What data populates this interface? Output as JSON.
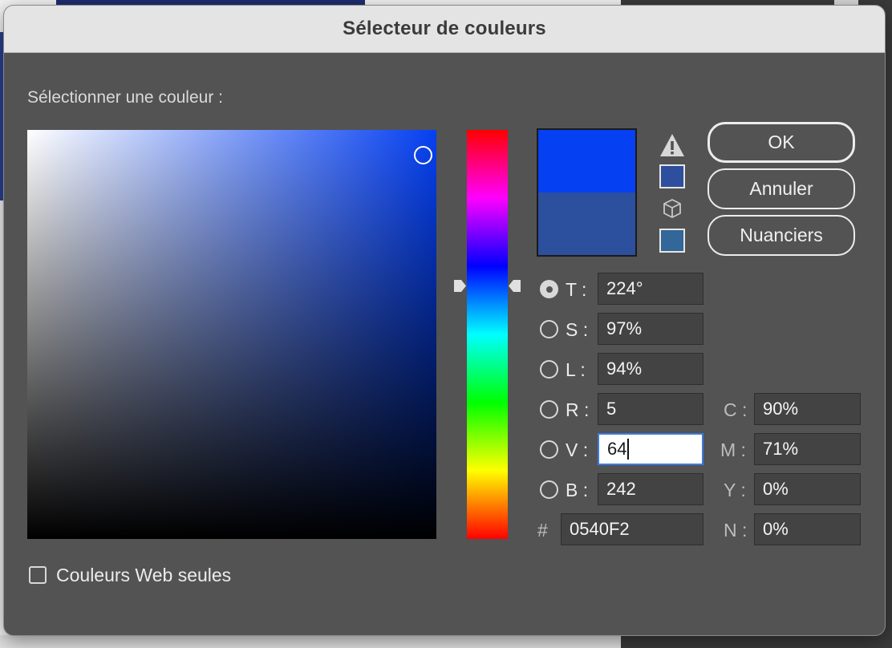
{
  "dialog": {
    "title": "Sélecteur de couleurs",
    "select_label": "Sélectionner une couleur :"
  },
  "colors": {
    "new_color": "#0540f2",
    "old_color": "#2c4f9e",
    "gamut_swatch": "#2d4f9d",
    "web_swatch": "#336699"
  },
  "icons": {
    "gamut_warning": "warning-triangle-icon",
    "web_safe": "cube-icon"
  },
  "buttons": {
    "ok": "OK",
    "cancel": "Annuler",
    "swatches": "Nuanciers"
  },
  "hsb": {
    "h_label": "T :",
    "h_value": "224°",
    "s_label": "S :",
    "s_value": "97%",
    "b_label": "L :",
    "b_value": "94%",
    "selected": "T"
  },
  "rgb": {
    "r_label": "R :",
    "r_value": "5",
    "g_label": "V :",
    "g_value": "64",
    "b_label": "B :",
    "b_value": "242"
  },
  "hex": {
    "label": "#",
    "value": "0540F2"
  },
  "cmyk": {
    "c_label": "C :",
    "c_value": "90%",
    "m_label": "M :",
    "m_value": "71%",
    "y_label": "Y :",
    "y_value": "0%",
    "k_label": "N :",
    "k_value": "0%"
  },
  "options": {
    "web_only_label": "Couleurs Web seules",
    "web_only_checked": false
  }
}
